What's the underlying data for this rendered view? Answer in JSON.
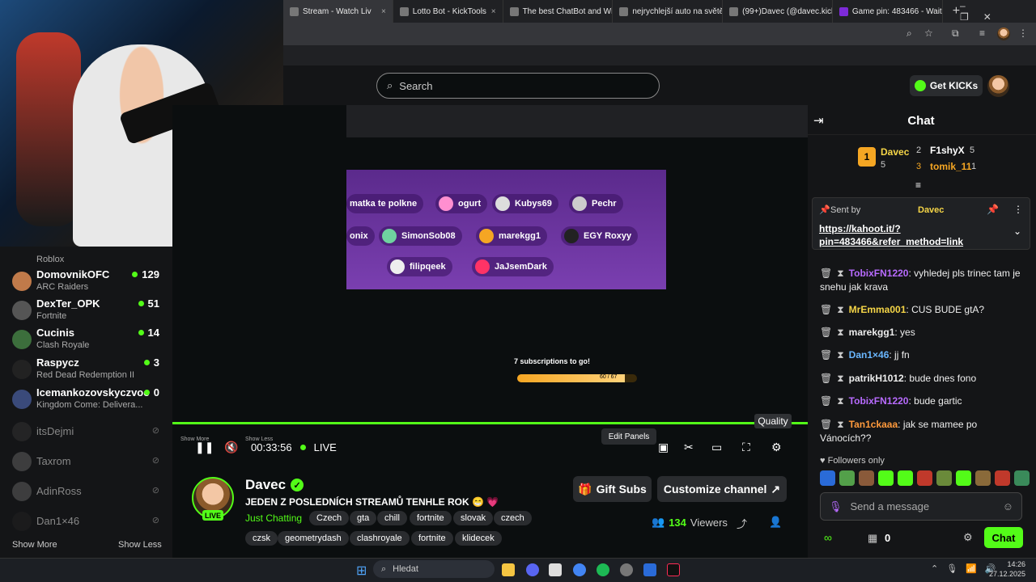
{
  "browser": {
    "tabs": [
      {
        "label": "Stream - Watch Liv",
        "active": true
      },
      {
        "label": "Lotto Bot - KickTools"
      },
      {
        "label": "The best ChatBot and Wi"
      },
      {
        "label": "nejrychlejší auto na světě"
      },
      {
        "label": "(99+)Davec (@davec.kick"
      },
      {
        "label": "Game pin: 483466 - Wait"
      }
    ]
  },
  "header": {
    "search_placeholder": "Search",
    "get_kicks": "Get KICKs"
  },
  "sidebar": {
    "items": [
      {
        "name": "",
        "category": "Roblox",
        "count": ""
      },
      {
        "name": "DomovnikOFC",
        "category": "ARC Raiders",
        "count": "129"
      },
      {
        "name": "DexTer_OPK",
        "category": "Fortnite",
        "count": "51"
      },
      {
        "name": "Cucinis",
        "category": "Clash Royale",
        "count": "14"
      },
      {
        "name": "Raspycz",
        "category": "Red Dead Redemption II",
        "count": "3"
      },
      {
        "name": "Icemankozovskyczvoe",
        "category": "Kingdom Come: Delivera...",
        "count": "0"
      }
    ],
    "offline": [
      {
        "name": "itsDejmi"
      },
      {
        "name": "Taxrom"
      },
      {
        "name": "AdinRoss"
      },
      {
        "name": "Dan1×46"
      }
    ],
    "show_more": "Show More",
    "show_less": "Show Less"
  },
  "nested": {
    "players": [
      "matka te polkne",
      "ogurt",
      "Kubys69",
      "Pechr",
      "onix",
      "SimonSob08",
      "marekgg1",
      "EGY Roxyy",
      "filipqeek",
      "JaJsemDark"
    ],
    "subs_goal": "7 subscriptions to go!",
    "subs_progress": "60 / 67"
  },
  "player": {
    "show_more": "Show More",
    "show_less": "Show Less",
    "time": "00:33:56",
    "live": "LIVE",
    "edit_panels": "Edit Panels",
    "quality_tooltip": "Quality"
  },
  "channel": {
    "name": "Davec",
    "title": "JEDEN Z POSLEDNÍCH STREAMŮ TENHLE ROK 😁 💗",
    "category": "Just Chatting",
    "tags": [
      "Czech",
      "gta",
      "chill",
      "fortnite",
      "slovak",
      "czech",
      "czsk",
      "geometrydash",
      "clashroyale",
      "fortnite",
      "klidecek"
    ],
    "gift_subs": "Gift Subs",
    "customize": "Customize channel",
    "viewers_count": "134",
    "viewers_label": "Viewers",
    "live_badge": "LIVE"
  },
  "chat": {
    "title": "Chat",
    "leaderboard": [
      {
        "rank": "1",
        "name": "Davec",
        "count": "5"
      },
      {
        "rank": "2",
        "name": "F1shyX",
        "count": "5"
      },
      {
        "rank": "3",
        "name": "tomik_11",
        "count": "1"
      }
    ],
    "pinned": {
      "sent_by_label": "Sent by",
      "sender": "Davec",
      "link": "https://kahoot.it/?pin=483466&refer_method=link"
    },
    "messages": [
      {
        "user": "TobixFN1220",
        "color": "#b86bff",
        "text": "vyhledej pls trinec tam je snehu jak krava"
      },
      {
        "user": "MrEmma001",
        "color": "#f5d547",
        "text": "CUS BUDE gtA?"
      },
      {
        "user": "marekgg1",
        "color": "#ffffff",
        "text": "yes"
      },
      {
        "user": "Dan1×46",
        "color": "#6ab7ff",
        "text": "jj fn"
      },
      {
        "user": "patrikH1012",
        "color": "#ffffff",
        "text": "bude dnes fono"
      },
      {
        "user": "TobixFN1220",
        "color": "#b86bff",
        "text": "bude gartic"
      },
      {
        "user": "Tan1ckaaa",
        "color": "#ff9a3c",
        "text": "jak se mamee po Vánocích??"
      }
    ],
    "followers_only": "Followers only",
    "input_placeholder": "Send a message",
    "points": "0",
    "chat_button": "Chat"
  },
  "taskbar": {
    "search": "Hledat",
    "time": "14:26",
    "date": "27.12.2025"
  }
}
